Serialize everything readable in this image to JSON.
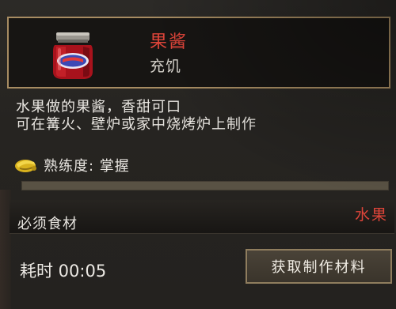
{
  "item": {
    "name": "果酱",
    "effect": "充饥",
    "icon": "jam-jar-icon"
  },
  "description": {
    "line1": "水果做的果酱，香甜可口",
    "line2": "可在篝火、壁炉或家中烧烤炉上制作"
  },
  "proficiency": {
    "label": "熟练度: 掌握",
    "icon": "proficiency-badge-icon"
  },
  "requirements": {
    "label": "必须食材",
    "value": "水果"
  },
  "time": {
    "label": "耗时 00:05"
  },
  "action": {
    "label": "获取制作材料"
  },
  "colors": {
    "highlight_red": "#e0453a",
    "card_border": "#a78c62",
    "button_border": "#8f7d5e",
    "text": "#e8e5e0"
  }
}
